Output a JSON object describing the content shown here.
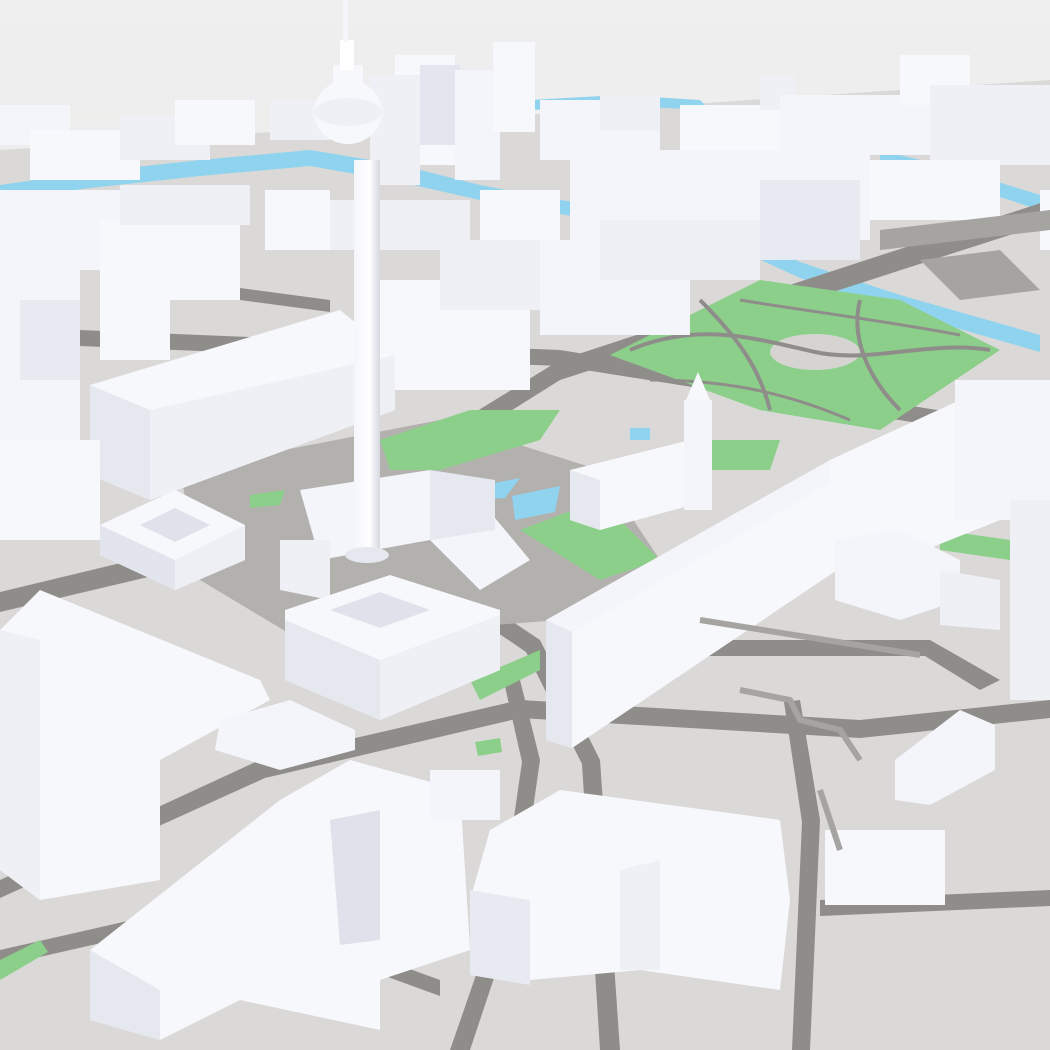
{
  "scene": {
    "kind": "isometric-3d-city-model",
    "colors": {
      "sky": "#ececec",
      "ground": "#d9d8d6",
      "street": "#8f8d8a",
      "street_light": "#a6a4a1",
      "grass": "#8ccf8a",
      "water": "#8fd3ef",
      "building_top": "#fbfcff",
      "building_light": "#eef0f6",
      "building_shade": "#d7dae3"
    },
    "features": [
      "tv-tower",
      "church-spire",
      "river",
      "park",
      "plaza",
      "apartment-blocks",
      "street-grid"
    ]
  }
}
